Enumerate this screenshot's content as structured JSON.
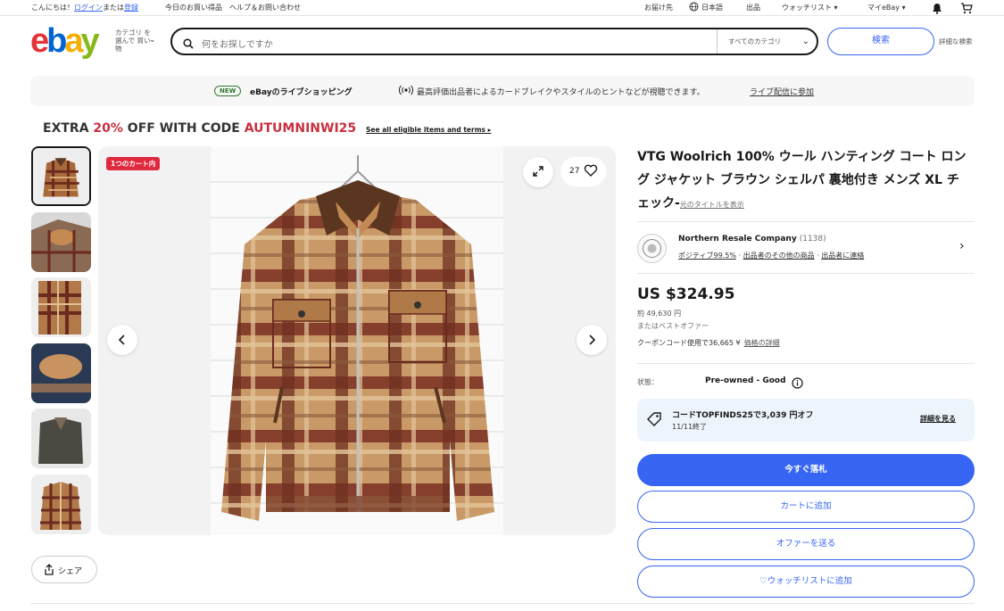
{
  "topbar": {
    "greeting_prefix": "こんにちは！",
    "signin": "ログイン",
    "or": "または",
    "register": "登録",
    "daily_deals": "今日のお買い得品",
    "help": "ヘルプ＆お問い合わせ",
    "ship_to": "お届け先",
    "language": "日本語",
    "sell": "出品",
    "watchlist": "ウォッチリスト ▾",
    "my_ebay": "マイeBay ▾"
  },
  "header": {
    "logo": {
      "e": "e",
      "b": "b",
      "a": "a",
      "y": "y"
    },
    "shop_by_category": "カテゴリ を選んで 買い物",
    "search_placeholder": "何をお探しですか",
    "category_select": "すべてのカテゴリ",
    "search_button": "検索",
    "advanced": "詳細な検索"
  },
  "banner": {
    "badge": "NEW",
    "title": "eBayのライブショッピング",
    "text": "最高評価出品者によるカードブレイクやスタイルのヒントなどが視聴できます。",
    "link": "ライブ配信に参加"
  },
  "promo": {
    "prefix": "EXTRA",
    "discount": "20%",
    "middle": "OFF WITH CODE",
    "code": "AUTUMNINWI25",
    "terms": "See all eligible items and terms ▸"
  },
  "gallery": {
    "cart_badge": "1つのカート内",
    "watch_count": "27"
  },
  "share": {
    "label": "シェア"
  },
  "item": {
    "title": "VTG Woolrich 100% ウール ハンティング コート ロング ジャケット ブラウン シェルパ 裏地付き メンズ XL チェック-",
    "original_title_link": "元のタイトルを表示"
  },
  "seller": {
    "name": "Northern Resale Company",
    "feedback_count": "(1138)",
    "positive": "ポジティブ99.5%",
    "other_items": "出品者のその他の商品",
    "contact": "出品者に連絡"
  },
  "price": {
    "main": "US $324.95",
    "approx": "約 49,630 円",
    "best_offer": "またはベストオファー",
    "coupon_text": "クーポンコード使用で36,665 ¥",
    "coupon_link": "価格の詳細"
  },
  "condition": {
    "label": "状態：",
    "value": "Pre-owned - Good"
  },
  "coupon_box": {
    "line1": "コードTOPFINDS25で3,039 円オフ",
    "line2": "11/11終了",
    "details": "詳細を見る"
  },
  "buttons": {
    "buy_now": "今すぐ落札",
    "add_to_cart": "カートに追加",
    "make_offer": "オファーを送る",
    "watchlist": "♡ウォッチリストに追加"
  },
  "colors": {
    "accent": "#3665f3",
    "promo_red": "#c9303f",
    "badge_red": "#e0293f"
  }
}
